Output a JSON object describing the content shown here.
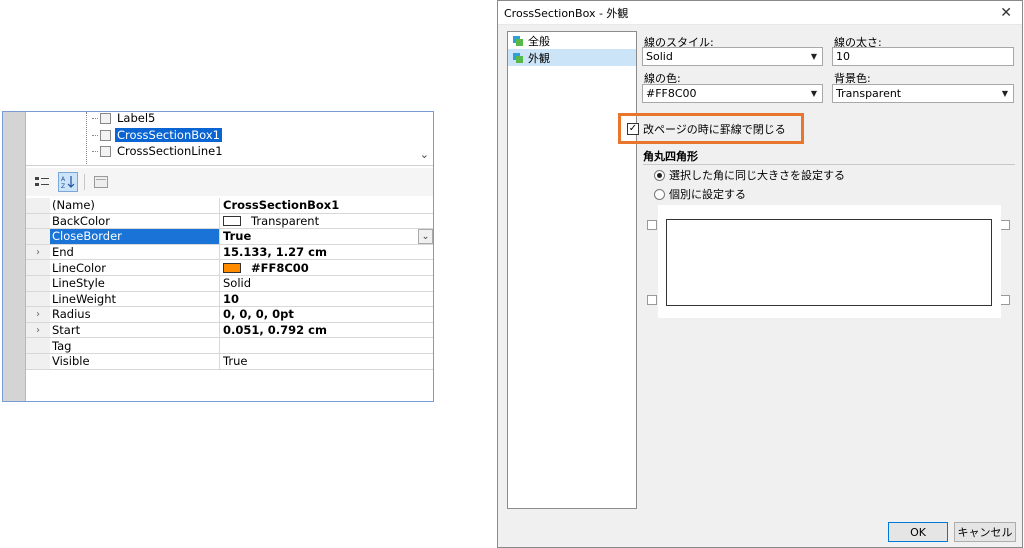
{
  "property_grid": {
    "tree_items": [
      {
        "label": "Label5",
        "selected": false
      },
      {
        "label": "CrossSectionBox1",
        "selected": true
      },
      {
        "label": "CrossSectionLine1",
        "selected": false
      }
    ],
    "toolbar": {
      "categorized_icon": "categorized-icon",
      "alphabetical_icon": "sort-az-icon",
      "property_pages_icon": "property-pages-icon"
    },
    "rows": [
      {
        "name": "(Name)",
        "value": "CrossSectionBox1",
        "bold": true,
        "expandable": false
      },
      {
        "name": "BackColor",
        "value": "Transparent",
        "bold": false,
        "expandable": false,
        "swatch": "#ffffff"
      },
      {
        "name": "CloseBorder",
        "value": "True",
        "bold": true,
        "expandable": false,
        "selected": true
      },
      {
        "name": "End",
        "value": "15.133, 1.27 cm",
        "bold": true,
        "expandable": true
      },
      {
        "name": "LineColor",
        "value": "#FF8C00",
        "bold": true,
        "expandable": false,
        "swatch": "#ff8c00"
      },
      {
        "name": "LineStyle",
        "value": "Solid",
        "bold": false,
        "expandable": false
      },
      {
        "name": "LineWeight",
        "value": "10",
        "bold": true,
        "expandable": false
      },
      {
        "name": "Radius",
        "value": "0, 0, 0, 0pt",
        "bold": true,
        "expandable": true
      },
      {
        "name": "Start",
        "value": "0.051, 0.792 cm",
        "bold": true,
        "expandable": true
      },
      {
        "name": "Tag",
        "value": "",
        "bold": false,
        "expandable": false
      },
      {
        "name": "Visible",
        "value": "True",
        "bold": false,
        "expandable": false
      }
    ]
  },
  "dialog": {
    "title": "CrossSectionBox - 外観",
    "nav": [
      {
        "label": "全般",
        "selected": false
      },
      {
        "label": "外観",
        "selected": true
      }
    ],
    "line_style_label": "線のスタイル:",
    "line_style_value": "Solid",
    "line_weight_label": "線の太さ:",
    "line_weight_value": "10",
    "line_color_label": "線の色:",
    "line_color_value": "#FF8C00",
    "back_color_label": "背景色:",
    "back_color_value": "Transparent",
    "close_border_label": "改ページの時に罫線で閉じる",
    "close_border_checked": true,
    "rounded_section_title": "角丸四角形",
    "radio_same": "選択した角に同じ大きさを設定する",
    "radio_individual": "個別に設定する",
    "ok_label": "OK",
    "cancel_label": "キャンセル",
    "highlight_color": "#e8762d"
  }
}
